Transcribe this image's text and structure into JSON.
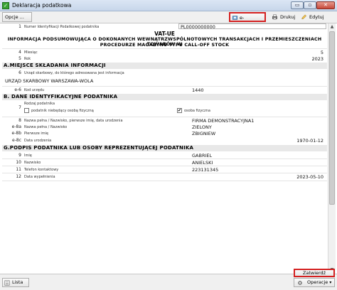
{
  "window": {
    "title": "Deklaracja podatkowa",
    "minimize_glyph": "▭",
    "maximize_glyph": "▫",
    "close_glyph": "✕"
  },
  "toolbar": {
    "options_label": "Opcje ...",
    "edeclaration_label": "e-Deklaracja",
    "print_label": "Drukuj",
    "print_dropdown_glyph": "▾",
    "edit_label": "Edytuj"
  },
  "form": {
    "field1": {
      "num": "1",
      "label": "Numer Identyfikacji Podatkowej podatnika",
      "value": "PL0000000000"
    },
    "header": {
      "title": "VAT-UE",
      "subtitle_line1": "INFORMACJA PODSUMOWUJĄCA O DOKONANYCH WEWNĄTRZWSPÓLNOTOWYCH TRANSAKCJACH I PRZEMIESZCZENIACH TOWARÓW W",
      "subtitle_line2": "PROCEDURZE MAGAZYNU TYPU CALL-OFF STOCK"
    },
    "field4": {
      "num": "4",
      "label": "Miesiąc",
      "value": "5"
    },
    "field5": {
      "num": "5",
      "label": "Rok",
      "value": "2023"
    },
    "sectionA": "A.MIEJSCE SKŁADANIA INFORMACJI",
    "field6": {
      "num": "6",
      "label": "Urząd skarbowy, do którego adresowana jest informacja",
      "value": "URZĄD SKARBOWY WARSZAWA-WOLA"
    },
    "fieldE6": {
      "num": "e-6",
      "label": "Kod urzędu",
      "value": "1440"
    },
    "sectionB": "B. DANE IDENTYFIKACYJNE PODATNIKA",
    "field7": {
      "num": "7",
      "label": "Rodzaj podatnika",
      "opt1": "podatnik niebędący osobą fizyczną",
      "opt1_checked": false,
      "opt2": "osoba fizyczna",
      "opt2_checked": true,
      "check_glyph": "✔"
    },
    "field8": {
      "num": "8",
      "label": "Nazwa pełna / Nazwisko, pierwsze imię, data urodzenia",
      "value": "FIRMA DEMONSTRACYJNA1"
    },
    "field8a": {
      "num": "e-8a",
      "label": "Nazwa pełna / Nazwisko",
      "value": "ZIELONY"
    },
    "field8b": {
      "num": "e-8b",
      "label": "Pierwsze imię",
      "value": "ZBIGNIEW"
    },
    "field8c": {
      "num": "e-8c",
      "label": "Data urodzenia",
      "value": "1970-01-12"
    },
    "sectionG": "G.PODPIS PODATNIKA LUB OSOBY REPREZENTUJĄCEJ PODATNIKA",
    "field9": {
      "num": "9",
      "label": "Imię",
      "value": "GABRIEL"
    },
    "field10": {
      "num": "10",
      "label": "Nazwisko",
      "value": "ANIELSKI"
    },
    "field11": {
      "num": "11",
      "label": "Telefon kontaktowy",
      "value": "223131345"
    },
    "field12": {
      "num": "12",
      "label": "Data wypełnienia",
      "value": "2023-05-10"
    }
  },
  "scrollbar": {
    "up_glyph": "▲",
    "down_glyph": "▼"
  },
  "bottombar": {
    "list_label": "Lista",
    "confirm_label": "Zatwierdź",
    "operations_label": "Operacje",
    "operations_dropdown_glyph": "▾"
  },
  "colors": {
    "highlight_border": "#d42020",
    "section_bg": "#e8e8e8",
    "app_icon": "#3aa335"
  }
}
